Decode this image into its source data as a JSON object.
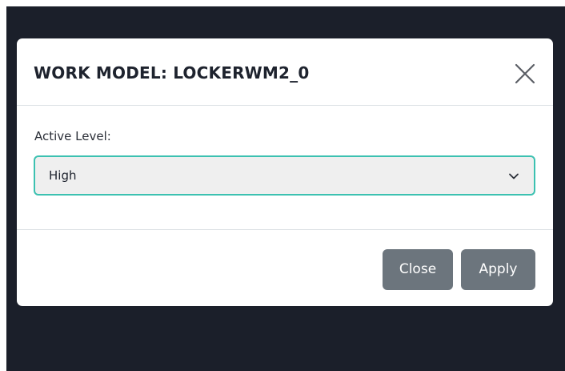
{
  "modal": {
    "title": "WORK MODEL: LOCKERWM2_0",
    "close_icon": "close-x-icon"
  },
  "form": {
    "active_level_label": "Active Level:",
    "active_level_value": "High",
    "dropdown_icon": "chevron-down-icon",
    "focus_border_color": "#3cc1b1"
  },
  "footer": {
    "close_label": "Close",
    "apply_label": "Apply",
    "button_color": "#6c757d"
  },
  "colors": {
    "backdrop": "#1b1f2a"
  }
}
